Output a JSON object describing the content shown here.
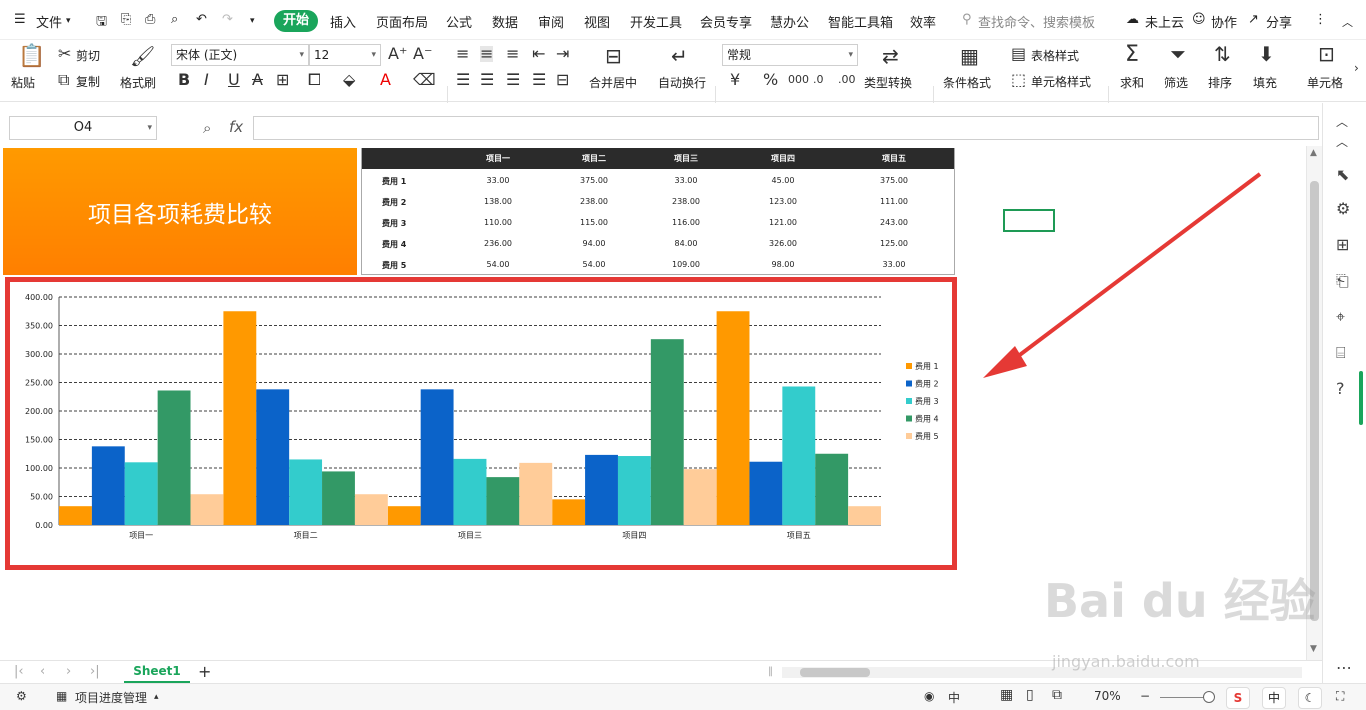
{
  "menubar": {
    "file": "文件",
    "tabs": [
      "开始",
      "插入",
      "页面布局",
      "公式",
      "数据",
      "审阅",
      "视图",
      "开发工具",
      "会员专享",
      "慧办公",
      "智能工具箱",
      "效率"
    ],
    "search_placeholder": "查找命令、搜索模板",
    "cloud": "未上云",
    "collab": "协作",
    "share": "分享"
  },
  "ribbon": {
    "paste": "粘贴",
    "cut": "剪切",
    "copy": "复制",
    "format_painter": "格式刷",
    "font_name": "宋体 (正文)",
    "font_size": "12",
    "merge": "合并居中",
    "wrap": "自动换行",
    "number_format": "常规",
    "type_convert": "类型转换",
    "cond_format": "条件格式",
    "table_style": "表格样式",
    "cell_style": "单元格样式",
    "sum": "求和",
    "filter": "筛选",
    "sort": "排序",
    "fill": "填充",
    "cell": "单元格"
  },
  "formula": {
    "namebox": "O4",
    "fx": "fx",
    "value": ""
  },
  "sheet": {
    "title": "项目各项耗费比较",
    "table_headers": [
      "项目一",
      "项目二",
      "项目三",
      "项目四",
      "项目五"
    ],
    "table_rows": [
      {
        "label": "费用 1",
        "values": [
          "33.00",
          "375.00",
          "33.00",
          "45.00",
          "375.00"
        ]
      },
      {
        "label": "费用 2",
        "values": [
          "138.00",
          "238.00",
          "238.00",
          "123.00",
          "111.00"
        ]
      },
      {
        "label": "费用 3",
        "values": [
          "110.00",
          "115.00",
          "116.00",
          "121.00",
          "243.00"
        ]
      },
      {
        "label": "费用 4",
        "values": [
          "236.00",
          "94.00",
          "84.00",
          "326.00",
          "125.00"
        ]
      },
      {
        "label": "费用 5",
        "values": [
          "54.00",
          "54.00",
          "109.00",
          "98.00",
          "33.00"
        ]
      }
    ]
  },
  "chart_data": {
    "type": "bar",
    "categories": [
      "项目一",
      "项目二",
      "项目三",
      "项目四",
      "项目五"
    ],
    "series": [
      {
        "name": "费用 1",
        "values": [
          33,
          375,
          33,
          45,
          375
        ],
        "color": "#ff9900"
      },
      {
        "name": "费用 2",
        "values": [
          138,
          238,
          238,
          123,
          111
        ],
        "color": "#0b63c9"
      },
      {
        "name": "费用 3",
        "values": [
          110,
          115,
          116,
          121,
          243
        ],
        "color": "#33cccc"
      },
      {
        "name": "费用 4",
        "values": [
          236,
          94,
          84,
          326,
          125
        ],
        "color": "#339966"
      },
      {
        "name": "费用 5",
        "values": [
          54,
          54,
          109,
          98,
          33
        ],
        "color": "#ffcc99"
      }
    ],
    "yticks": [
      "0.00",
      "50.00",
      "100.00",
      "150.00",
      "200.00",
      "250.00",
      "300.00",
      "350.00",
      "400.00"
    ],
    "ylim": [
      0,
      400
    ],
    "grid": true,
    "legend": "right"
  },
  "tabbar": {
    "sheet_name": "Sheet1",
    "add": "+"
  },
  "statusbar": {
    "app_label": "项目进度管理",
    "zoom": "70%",
    "ime_1": "中",
    "ime_2": "中"
  },
  "watermark": {
    "logo": "Bai du 经验",
    "url": "jingyan.baidu.com"
  }
}
